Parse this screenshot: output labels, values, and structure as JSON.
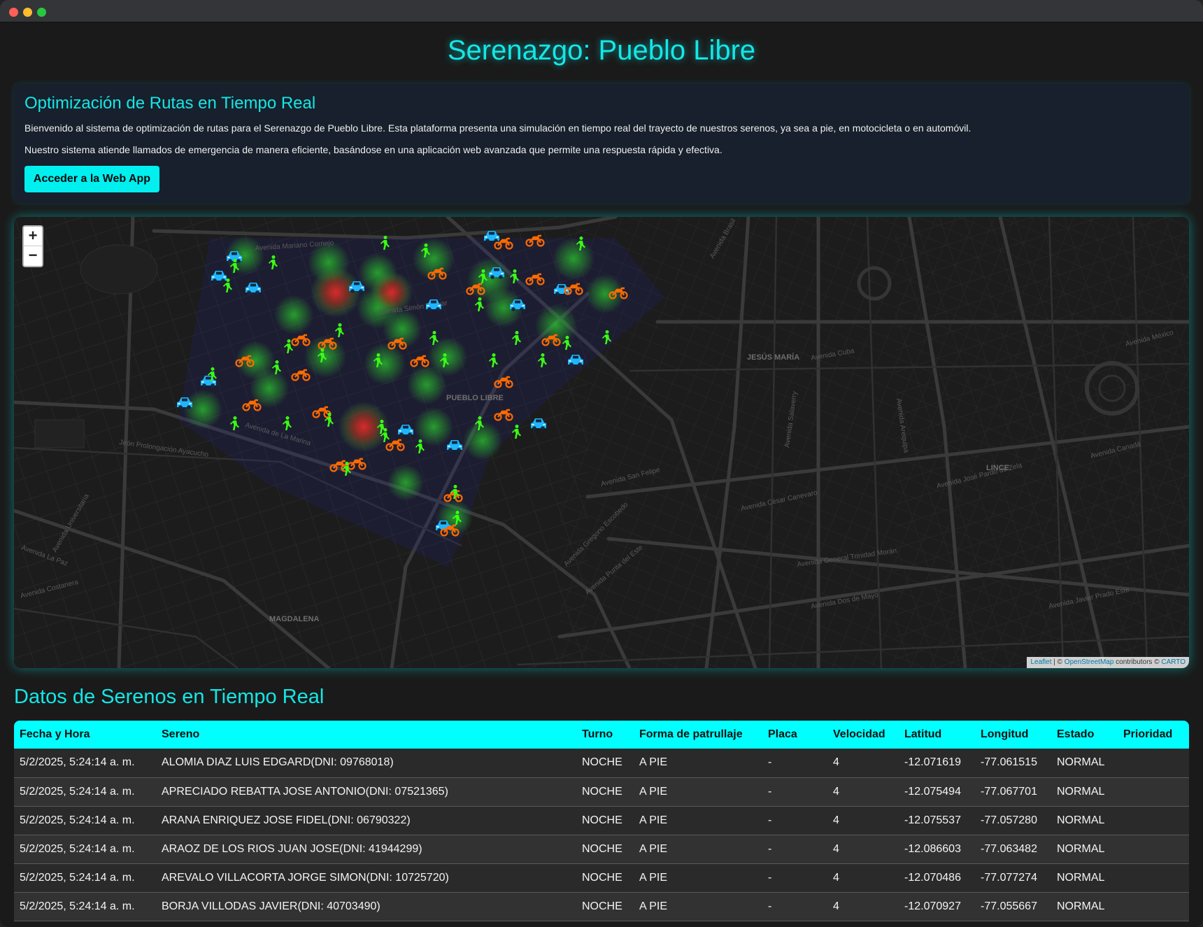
{
  "header": {
    "title": "Serenazgo: Pueblo Libre"
  },
  "intro": {
    "heading": "Optimización de Rutas en Tiempo Real",
    "paragraph1": "Bienvenido al sistema de optimización de rutas para el Serenazgo de Pueblo Libre. Esta plataforma presenta una simulación en tiempo real del trayecto de nuestros serenos, ya sea a pie, en motocicleta o en automóvil.",
    "paragraph2": "Nuestro sistema atiende llamados de emergencia de manera eficiente, basándose en una aplicación web avanzada que permite una respuesta rápida y efectiva.",
    "button_label": "Acceder a la Web App"
  },
  "map": {
    "zoom_in": "+",
    "zoom_out": "−",
    "attribution": {
      "leaflet": "Leaflet",
      "sep": " | © ",
      "osm": "OpenStreetMap",
      "contrib": " contributors © ",
      "carto": "CARTO"
    },
    "district_labels": [
      "PUEBLO LIBRE",
      "JESÚS MARÍA",
      "LINCE",
      "MAGDALENA"
    ],
    "street_labels": [
      "Avenida Mariano Cornejo",
      "Avenida Simón Bolívar",
      "Avenida de La Marina",
      "Avenida Brasil",
      "Avenida Cuba",
      "Avenida San Felipe",
      "Avenida César Canevaro",
      "Avenida Salaverry",
      "Avenida Arequipa",
      "Avenida Canadá",
      "Avenida José Pardo de Zela",
      "Avenida Universitaria",
      "Avenida La Paz",
      "Avenida Costanera",
      "Jirón Prolongación Ayacucho",
      "Avenida Javier Prado Este",
      "Avenida México",
      "Avenida Dos de Mayo",
      "Avenida General Trinidad Morán",
      "Avenida Gregorio Escobedo",
      "Avenida Punta del Este"
    ],
    "marker_colors": {
      "walk": "#39ff14",
      "moto": "#ff6a00",
      "car": "#1fb6ff"
    }
  },
  "table": {
    "section_title": "Datos de Serenos en Tiempo Real",
    "headers": [
      "Fecha y Hora",
      "Sereno",
      "Turno",
      "Forma de patrullaje",
      "Placa",
      "Velocidad",
      "Latitud",
      "Longitud",
      "Estado",
      "Prioridad"
    ],
    "rows": [
      [
        "5/2/2025, 5:24:14 a. m.",
        "ALOMIA DIAZ LUIS EDGARD(DNI: 09768018)",
        "NOCHE",
        "A PIE",
        "-",
        "4",
        "-12.071619",
        "-77.061515",
        "NORMAL",
        ""
      ],
      [
        "5/2/2025, 5:24:14 a. m.",
        "APRECIADO REBATTA JOSE ANTONIO(DNI: 07521365)",
        "NOCHE",
        "A PIE",
        "-",
        "4",
        "-12.075494",
        "-77.067701",
        "NORMAL",
        ""
      ],
      [
        "5/2/2025, 5:24:14 a. m.",
        "ARANA ENRIQUEZ JOSE FIDEL(DNI: 06790322)",
        "NOCHE",
        "A PIE",
        "-",
        "4",
        "-12.075537",
        "-77.057280",
        "NORMAL",
        ""
      ],
      [
        "5/2/2025, 5:24:14 a. m.",
        "ARAOZ DE LOS RIOS JUAN JOSE(DNI: 41944299)",
        "NOCHE",
        "A PIE",
        "-",
        "4",
        "-12.086603",
        "-77.063482",
        "NORMAL",
        ""
      ],
      [
        "5/2/2025, 5:24:14 a. m.",
        "AREVALO VILLACORTA JORGE SIMON(DNI: 10725720)",
        "NOCHE",
        "A PIE",
        "-",
        "4",
        "-12.070486",
        "-77.077274",
        "NORMAL",
        ""
      ],
      [
        "5/2/2025, 5:24:14 a. m.",
        "BORJA VILLODAS JAVIER(DNI: 40703490)",
        "NOCHE",
        "A PIE",
        "-",
        "4",
        "-12.070927",
        "-77.055667",
        "NORMAL",
        ""
      ]
    ]
  }
}
